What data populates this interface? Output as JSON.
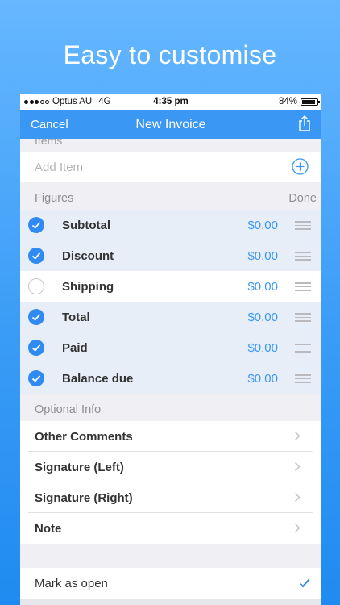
{
  "headline": "Easy to customise",
  "status_bar": {
    "carrier": "Optus AU",
    "network": "4G",
    "time": "4:35 pm",
    "battery": "84%"
  },
  "nav": {
    "cancel": "Cancel",
    "title": "New Invoice",
    "share_icon": "share-icon"
  },
  "items_section": {
    "header": "Items",
    "add_item_placeholder": "Add Item",
    "add_icon": "plus-circle-icon"
  },
  "figures": {
    "header": "Figures",
    "done": "Done",
    "rows": [
      {
        "label": "Subtotal",
        "value": "$0.00",
        "checked": true
      },
      {
        "label": "Discount",
        "value": "$0.00",
        "checked": true
      },
      {
        "label": "Shipping",
        "value": "$0.00",
        "checked": false
      },
      {
        "label": "Total",
        "value": "$0.00",
        "checked": true
      },
      {
        "label": "Paid",
        "value": "$0.00",
        "checked": true
      },
      {
        "label": "Balance due",
        "value": "$0.00",
        "checked": true
      }
    ]
  },
  "optional_info": {
    "header": "Optional Info",
    "rows": [
      {
        "label": "Other Comments"
      },
      {
        "label": "Signature  (Left)"
      },
      {
        "label": "Signature  (Right)"
      },
      {
        "label": "Note"
      }
    ]
  },
  "mark_as_open": {
    "label": "Mark as open",
    "checked": true
  },
  "colors": {
    "accent": "#3a97f3",
    "selected_row": "#e8eef8",
    "section_text": "#8e8e93"
  }
}
